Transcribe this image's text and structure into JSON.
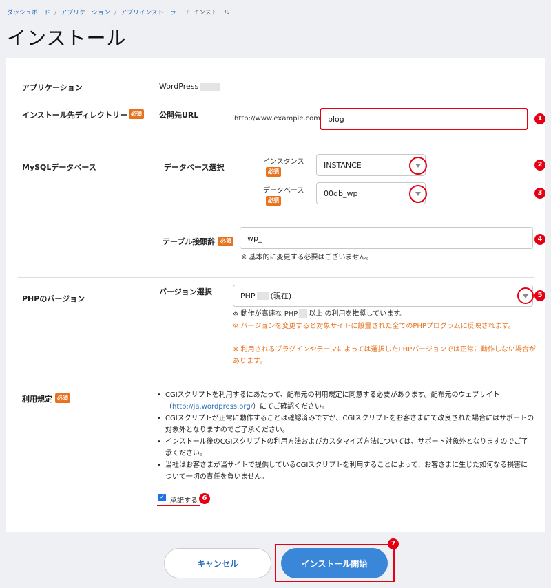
{
  "breadcrumb": {
    "items": [
      "ダッシュボード",
      "アプリケーション",
      "アプリインストーラー"
    ],
    "current": "インストール"
  },
  "page_title": "インストール",
  "required_badge": "必須",
  "application": {
    "label": "アプリケーション",
    "value": "WordPress"
  },
  "install_dir": {
    "label": "インストール先ディレクトリー",
    "sub_label": "公開先URL",
    "url_prefix": "http://www.example.com/",
    "value": "blog"
  },
  "mysql": {
    "label": "MySQLデータベース",
    "db_select_label": "データベース選択",
    "instance_label": "インスタンス",
    "instance_value": "INSTANCE",
    "database_label": "データベース",
    "database_value": "00db_wp",
    "prefix_label": "テーブル接頭辞",
    "prefix_value": "wp_",
    "prefix_note": "※ 基本的に変更する必要はございません。"
  },
  "php": {
    "label": "PHPのバージョン",
    "version_label": "バージョン選択",
    "version_prefix": "PHP",
    "version_suffix": "(現在)",
    "note_prefix": "※ 動作が高速な PHP",
    "note_suffix": "以上 の利用を推奨しています。",
    "warning1": "※ バージョンを変更すると対象サイトに設置された全てのPHPプログラムに反映されます。",
    "warning2": "※ 利用されるプラグインやテーマによっては選択したPHPバージョンでは正常に動作しない場合があります。"
  },
  "terms": {
    "label": "利用規定",
    "item1_a": "CGIスクリプトを利用するにあたって、配布元の利用規定に同意する必要があります。配布元のウェブサイト（",
    "item1_link": "http://ja.wordpress.org/",
    "item1_b": "）にてご確認ください。",
    "item2": "CGIスクリプトが正常に動作することは確認済みですが、CGIスクリプトをお客さまにて改良された場合にはサポートの対象外となりますのでご了承ください。",
    "item3": "インストール後のCGIスクリプトの利用方法およびカスタマイズ方法については、サポート対象外となりますのでご了承ください。",
    "item4": "当社はお客さまが当サイトで提供しているCGIスクリプトを利用することによって、お客さまに生じた如何なる損害について一切の責任を負いません。",
    "agree_label": "承諾する",
    "agree_checked": true
  },
  "buttons": {
    "cancel": "キャンセル",
    "install": "インストール開始"
  },
  "markers": [
    "1",
    "2",
    "3",
    "4",
    "5",
    "6",
    "7"
  ],
  "colors": {
    "accent": "#3a86d9",
    "badge": "#e8731f",
    "highlight": "#e60012",
    "link": "#2a6ebb"
  }
}
